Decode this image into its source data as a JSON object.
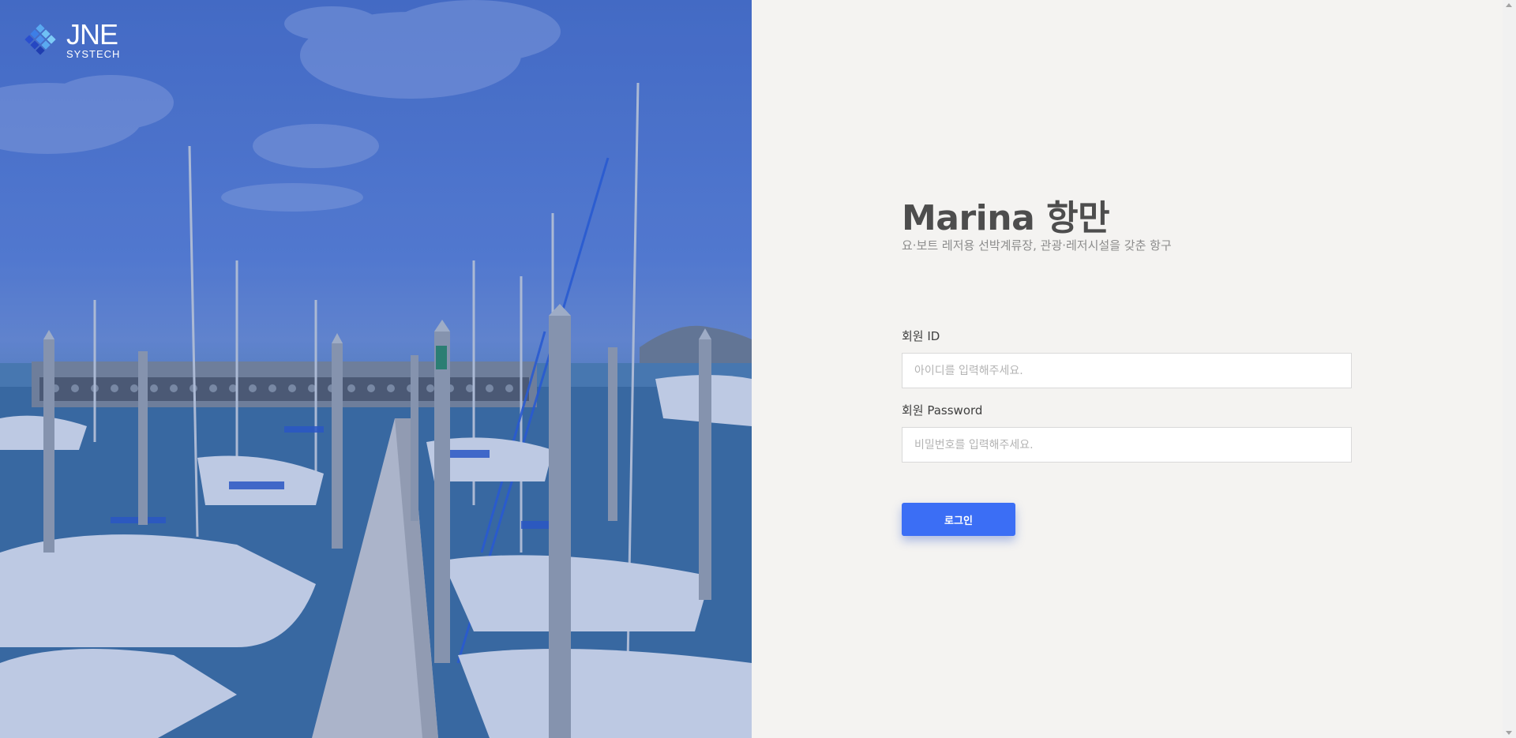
{
  "logo": {
    "name": "JNE",
    "tagline": "SYSTECH"
  },
  "hero": {
    "image": "marina-harbor-photo",
    "overlay_color": "#2846b4"
  },
  "login": {
    "title": "Marina 항만",
    "subtitle": "요·보트 레저용 선박계류장, 관광·레저시설을 갖춘 항구",
    "id_label": "회원 ID",
    "id_placeholder": "아이디를 입력해주세요.",
    "id_value": "",
    "password_label": "회원 Password",
    "password_placeholder": "비밀번호를 입력해주세요.",
    "password_value": "",
    "submit_label": "로그인"
  },
  "colors": {
    "accent": "#3b6ef5",
    "panel_bg": "#f4f3f1",
    "title": "#4d4d4d",
    "subtitle": "#8c8c8c"
  }
}
